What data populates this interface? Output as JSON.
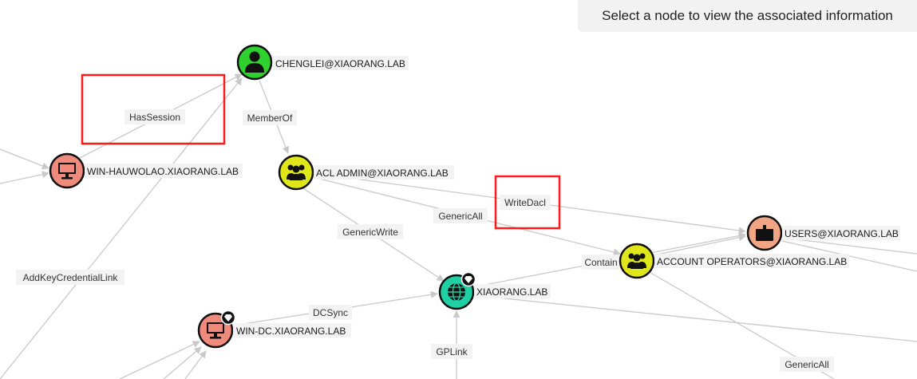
{
  "info_panel": {
    "text": "Select a node to view the associated information"
  },
  "colors": {
    "user": "#2ed12e",
    "group": "#dfe61a",
    "computer": "#ef8a7c",
    "domain": "#1fd0a4",
    "ou": "#f2a584",
    "edge": "#c9c9c9",
    "highlight": "#ff1a1a"
  },
  "nodes": [
    {
      "id": "chenglei",
      "label": "CHENGLEI@XIAORANG.LAB",
      "kind": "user",
      "icon": "user-icon"
    },
    {
      "id": "acladmin",
      "label": "ACL ADMIN@XIAORANG.LAB",
      "kind": "group",
      "icon": "group-icon"
    },
    {
      "id": "hauwolao",
      "label": "WIN-HAUWOLAO.XIAORANG.LAB",
      "kind": "computer",
      "icon": "computer-icon"
    },
    {
      "id": "users",
      "label": "USERS@XIAORANG.LAB",
      "kind": "ou",
      "icon": "container-icon"
    },
    {
      "id": "accountops",
      "label": "ACCOUNT OPERATORS@XIAORANG.LAB",
      "kind": "group",
      "icon": "group-icon"
    },
    {
      "id": "domain",
      "label": "XIAORANG.LAB",
      "kind": "domain",
      "icon": "globe-icon",
      "badge": "gem-icon"
    },
    {
      "id": "windc",
      "label": "WIN-DC.XIAORANG.LAB",
      "kind": "computer",
      "icon": "computer-icon",
      "badge": "gem-icon"
    }
  ],
  "edge_labels": {
    "hassession": "HasSession",
    "memberof": "MemberOf",
    "writedacl": "WriteDacl",
    "genericall_1": "GenericAll",
    "genericwrite": "GenericWrite",
    "addkey": "AddKeyCredentialLink",
    "contain": "Contain",
    "dcsync": "DCSync",
    "gplink": "GPLink",
    "genericall_2": "GenericAll"
  }
}
